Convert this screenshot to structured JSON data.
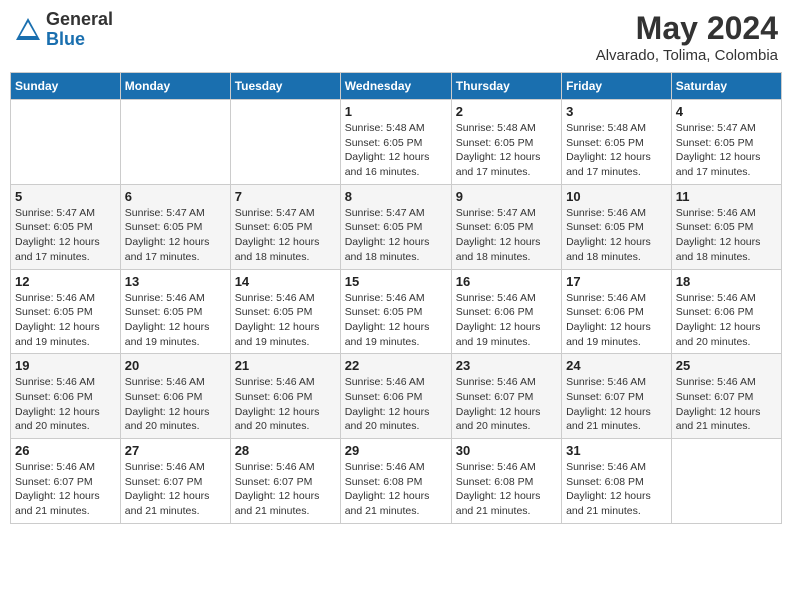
{
  "header": {
    "logo_general": "General",
    "logo_blue": "Blue",
    "month_year": "May 2024",
    "location": "Alvarado, Tolima, Colombia"
  },
  "days_of_week": [
    "Sunday",
    "Monday",
    "Tuesday",
    "Wednesday",
    "Thursday",
    "Friday",
    "Saturday"
  ],
  "weeks": [
    [
      {
        "day": "",
        "info": ""
      },
      {
        "day": "",
        "info": ""
      },
      {
        "day": "",
        "info": ""
      },
      {
        "day": "1",
        "info": "Sunrise: 5:48 AM\nSunset: 6:05 PM\nDaylight: 12 hours and 16 minutes."
      },
      {
        "day": "2",
        "info": "Sunrise: 5:48 AM\nSunset: 6:05 PM\nDaylight: 12 hours and 17 minutes."
      },
      {
        "day": "3",
        "info": "Sunrise: 5:48 AM\nSunset: 6:05 PM\nDaylight: 12 hours and 17 minutes."
      },
      {
        "day": "4",
        "info": "Sunrise: 5:47 AM\nSunset: 6:05 PM\nDaylight: 12 hours and 17 minutes."
      }
    ],
    [
      {
        "day": "5",
        "info": "Sunrise: 5:47 AM\nSunset: 6:05 PM\nDaylight: 12 hours and 17 minutes."
      },
      {
        "day": "6",
        "info": "Sunrise: 5:47 AM\nSunset: 6:05 PM\nDaylight: 12 hours and 17 minutes."
      },
      {
        "day": "7",
        "info": "Sunrise: 5:47 AM\nSunset: 6:05 PM\nDaylight: 12 hours and 18 minutes."
      },
      {
        "day": "8",
        "info": "Sunrise: 5:47 AM\nSunset: 6:05 PM\nDaylight: 12 hours and 18 minutes."
      },
      {
        "day": "9",
        "info": "Sunrise: 5:47 AM\nSunset: 6:05 PM\nDaylight: 12 hours and 18 minutes."
      },
      {
        "day": "10",
        "info": "Sunrise: 5:46 AM\nSunset: 6:05 PM\nDaylight: 12 hours and 18 minutes."
      },
      {
        "day": "11",
        "info": "Sunrise: 5:46 AM\nSunset: 6:05 PM\nDaylight: 12 hours and 18 minutes."
      }
    ],
    [
      {
        "day": "12",
        "info": "Sunrise: 5:46 AM\nSunset: 6:05 PM\nDaylight: 12 hours and 19 minutes."
      },
      {
        "day": "13",
        "info": "Sunrise: 5:46 AM\nSunset: 6:05 PM\nDaylight: 12 hours and 19 minutes."
      },
      {
        "day": "14",
        "info": "Sunrise: 5:46 AM\nSunset: 6:05 PM\nDaylight: 12 hours and 19 minutes."
      },
      {
        "day": "15",
        "info": "Sunrise: 5:46 AM\nSunset: 6:05 PM\nDaylight: 12 hours and 19 minutes."
      },
      {
        "day": "16",
        "info": "Sunrise: 5:46 AM\nSunset: 6:06 PM\nDaylight: 12 hours and 19 minutes."
      },
      {
        "day": "17",
        "info": "Sunrise: 5:46 AM\nSunset: 6:06 PM\nDaylight: 12 hours and 19 minutes."
      },
      {
        "day": "18",
        "info": "Sunrise: 5:46 AM\nSunset: 6:06 PM\nDaylight: 12 hours and 20 minutes."
      }
    ],
    [
      {
        "day": "19",
        "info": "Sunrise: 5:46 AM\nSunset: 6:06 PM\nDaylight: 12 hours and 20 minutes."
      },
      {
        "day": "20",
        "info": "Sunrise: 5:46 AM\nSunset: 6:06 PM\nDaylight: 12 hours and 20 minutes."
      },
      {
        "day": "21",
        "info": "Sunrise: 5:46 AM\nSunset: 6:06 PM\nDaylight: 12 hours and 20 minutes."
      },
      {
        "day": "22",
        "info": "Sunrise: 5:46 AM\nSunset: 6:06 PM\nDaylight: 12 hours and 20 minutes."
      },
      {
        "day": "23",
        "info": "Sunrise: 5:46 AM\nSunset: 6:07 PM\nDaylight: 12 hours and 20 minutes."
      },
      {
        "day": "24",
        "info": "Sunrise: 5:46 AM\nSunset: 6:07 PM\nDaylight: 12 hours and 21 minutes."
      },
      {
        "day": "25",
        "info": "Sunrise: 5:46 AM\nSunset: 6:07 PM\nDaylight: 12 hours and 21 minutes."
      }
    ],
    [
      {
        "day": "26",
        "info": "Sunrise: 5:46 AM\nSunset: 6:07 PM\nDaylight: 12 hours and 21 minutes."
      },
      {
        "day": "27",
        "info": "Sunrise: 5:46 AM\nSunset: 6:07 PM\nDaylight: 12 hours and 21 minutes."
      },
      {
        "day": "28",
        "info": "Sunrise: 5:46 AM\nSunset: 6:07 PM\nDaylight: 12 hours and 21 minutes."
      },
      {
        "day": "29",
        "info": "Sunrise: 5:46 AM\nSunset: 6:08 PM\nDaylight: 12 hours and 21 minutes."
      },
      {
        "day": "30",
        "info": "Sunrise: 5:46 AM\nSunset: 6:08 PM\nDaylight: 12 hours and 21 minutes."
      },
      {
        "day": "31",
        "info": "Sunrise: 5:46 AM\nSunset: 6:08 PM\nDaylight: 12 hours and 21 minutes."
      },
      {
        "day": "",
        "info": ""
      }
    ]
  ]
}
